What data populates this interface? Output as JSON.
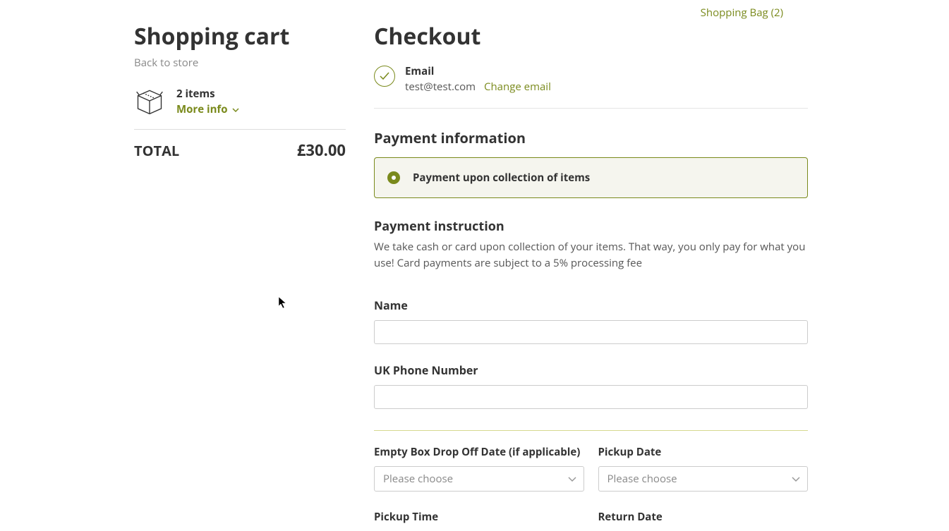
{
  "header": {
    "shopping_bag_link": "Shopping Bag (2)"
  },
  "cart": {
    "title": "Shopping cart",
    "back_link": "Back to store",
    "items_count": "2 items",
    "more_info": "More info",
    "total_label": "TOTAL",
    "total_amount": "£30.00"
  },
  "checkout": {
    "title": "Checkout",
    "email": {
      "label": "Email",
      "value": "test@test.com",
      "change_link": "Change email"
    },
    "payment_info_heading": "Payment information",
    "payment_option": "Payment upon collection of items",
    "payment_instruction_heading": "Payment instruction",
    "payment_instruction_text": "We take cash or card upon collection of your items. That way, you only pay for what you use! Card payments are subject to a 5% processing fee",
    "fields": {
      "name_label": "Name",
      "name_value": "",
      "phone_label": "UK Phone Number",
      "phone_value": "",
      "dropoff_label": "Empty Box Drop Off Date (if applicable)",
      "dropoff_placeholder": "Please choose",
      "pickup_date_label": "Pickup Date",
      "pickup_date_placeholder": "Please choose",
      "pickup_time_label": "Pickup Time",
      "return_date_label": "Return Date"
    }
  }
}
